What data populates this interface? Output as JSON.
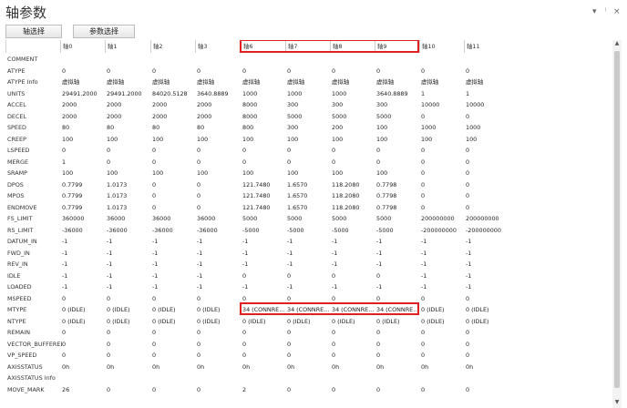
{
  "window": {
    "title": "轴参数",
    "controls": [
      "▾",
      "ᛌ",
      "×"
    ]
  },
  "toolbar": {
    "axis_select_label": "轴选择",
    "param_select_label": "参数选择"
  },
  "table": {
    "columns": [
      "",
      "轴0",
      "轴1",
      "轴2",
      "轴3",
      "轴6",
      "轴7",
      "轴8",
      "轴9",
      "轴10",
      "轴11"
    ],
    "rows": [
      {
        "label": "COMMENT",
        "values": [
          "",
          "",
          "",
          "",
          "",
          "",
          "",
          "",
          "",
          ""
        ]
      },
      {
        "label": "ATYPE",
        "values": [
          "0",
          "0",
          "0",
          "0",
          "0",
          "0",
          "0",
          "0",
          "0",
          "0"
        ]
      },
      {
        "label": "ATYPE Info",
        "values": [
          "虚拟轴",
          "虚拟轴",
          "虚拟轴",
          "虚拟轴",
          "虚拟轴",
          "虚拟轴",
          "虚拟轴",
          "虚拟轴",
          "虚拟轴",
          "虚拟轴"
        ]
      },
      {
        "label": "UNITS",
        "values": [
          "29491.2000",
          "29491.2000",
          "84020.5128",
          "3640.8889",
          "1000",
          "1000",
          "1000",
          "3640.8889",
          "1",
          "1"
        ]
      },
      {
        "label": "ACCEL",
        "values": [
          "2000",
          "2000",
          "2000",
          "2000",
          "8000",
          "300",
          "300",
          "300",
          "10000",
          "10000"
        ]
      },
      {
        "label": "DECEL",
        "values": [
          "2000",
          "2000",
          "2000",
          "2000",
          "8000",
          "5000",
          "5000",
          "5000",
          "0",
          "0"
        ]
      },
      {
        "label": "SPEED",
        "values": [
          "80",
          "80",
          "80",
          "80",
          "800",
          "300",
          "200",
          "100",
          "1000",
          "1000"
        ]
      },
      {
        "label": "CREEP",
        "values": [
          "100",
          "100",
          "100",
          "100",
          "100",
          "100",
          "100",
          "100",
          "100",
          "100"
        ]
      },
      {
        "label": "LSPEED",
        "values": [
          "0",
          "0",
          "0",
          "0",
          "0",
          "0",
          "0",
          "0",
          "0",
          "0"
        ]
      },
      {
        "label": "MERGE",
        "values": [
          "1",
          "0",
          "0",
          "0",
          "0",
          "0",
          "0",
          "0",
          "0",
          "0"
        ]
      },
      {
        "label": "SRAMP",
        "values": [
          "100",
          "100",
          "100",
          "100",
          "100",
          "100",
          "100",
          "100",
          "0",
          "0"
        ]
      },
      {
        "label": "DPOS",
        "values": [
          "0.7799",
          "1.0173",
          "0",
          "0",
          "121.7480",
          "1.6570",
          "118.2080",
          "0.7798",
          "0",
          "0"
        ]
      },
      {
        "label": "MPOS",
        "values": [
          "0.7799",
          "1.0173",
          "0",
          "0",
          "121.7480",
          "1.6570",
          "118.2080",
          "0.7798",
          "0",
          "0"
        ]
      },
      {
        "label": "ENDMOVE",
        "values": [
          "0.7799",
          "1.0173",
          "0",
          "0",
          "121.7480",
          "1.6570",
          "118.2080",
          "0.7798",
          "0",
          "0"
        ]
      },
      {
        "label": "FS_LIMIT",
        "values": [
          "360000",
          "36000",
          "36000",
          "36000",
          "5000",
          "5000",
          "5000",
          "5000",
          "200000000",
          "200000000"
        ]
      },
      {
        "label": "RS_LIMIT",
        "values": [
          "-36000",
          "-36000",
          "-36000",
          "-36000",
          "-5000",
          "-5000",
          "-5000",
          "-5000",
          "-200000000",
          "-200000000"
        ]
      },
      {
        "label": "DATUM_IN",
        "values": [
          "-1",
          "-1",
          "-1",
          "-1",
          "-1",
          "-1",
          "-1",
          "-1",
          "-1",
          "-1"
        ]
      },
      {
        "label": "FWD_IN",
        "values": [
          "-1",
          "-1",
          "-1",
          "-1",
          "-1",
          "-1",
          "-1",
          "-1",
          "-1",
          "-1"
        ]
      },
      {
        "label": "REV_IN",
        "values": [
          "-1",
          "-1",
          "-1",
          "-1",
          "-1",
          "-1",
          "-1",
          "-1",
          "-1",
          "-1"
        ]
      },
      {
        "label": "IDLE",
        "values": [
          "-1",
          "-1",
          "-1",
          "-1",
          "0",
          "0",
          "0",
          "0",
          "-1",
          "-1"
        ]
      },
      {
        "label": "LOADED",
        "values": [
          "-1",
          "-1",
          "-1",
          "-1",
          "-1",
          "-1",
          "-1",
          "-1",
          "-1",
          "-1"
        ]
      },
      {
        "label": "MSPEED",
        "values": [
          "0",
          "0",
          "0",
          "0",
          "0",
          "0",
          "0",
          "0",
          "0",
          "0"
        ]
      },
      {
        "label": "MTYPE",
        "values": [
          "0 (IDLE)",
          "0 (IDLE)",
          "0 (IDLE)",
          "0 (IDLE)",
          "34 (CONNRE...",
          "34 (CONNRE...",
          "34 (CONNRE...",
          "34 (CONNRE...",
          "0 (IDLE)",
          "0 (IDLE)"
        ]
      },
      {
        "label": "NTYPE",
        "values": [
          "0 (IDLE)",
          "0 (IDLE)",
          "0 (IDLE)",
          "0 (IDLE)",
          "0 (IDLE)",
          "0 (IDLE)",
          "0 (IDLE)",
          "0 (IDLE)",
          "0 (IDLE)",
          "0 (IDLE)"
        ]
      },
      {
        "label": "REMAIN",
        "values": [
          "0",
          "0",
          "0",
          "0",
          "0",
          "0",
          "0",
          "0",
          "0",
          "0"
        ]
      },
      {
        "label": "VECTOR_BUFFERED",
        "values": [
          "0",
          "0",
          "0",
          "0",
          "0",
          "0",
          "0",
          "0",
          "0",
          "0"
        ]
      },
      {
        "label": "VP_SPEED",
        "values": [
          "0",
          "0",
          "0",
          "0",
          "0",
          "0",
          "0",
          "0",
          "0",
          "0"
        ]
      },
      {
        "label": "AXISSTATUS",
        "values": [
          "0h",
          "0h",
          "0h",
          "0h",
          "0h",
          "0h",
          "0h",
          "0h",
          "0h",
          "0h"
        ]
      },
      {
        "label": "AXISSTATUS Info",
        "values": [
          "",
          "",
          "",
          "",
          "",
          "",
          "",
          "",
          "",
          ""
        ]
      },
      {
        "label": "MOVE_MARK",
        "values": [
          "26",
          "0",
          "0",
          "0",
          "2",
          "0",
          "0",
          "0",
          "0",
          "0"
        ]
      }
    ]
  },
  "colors": {
    "highlight": "#e02020",
    "grid_line": "#cfcfcf"
  }
}
